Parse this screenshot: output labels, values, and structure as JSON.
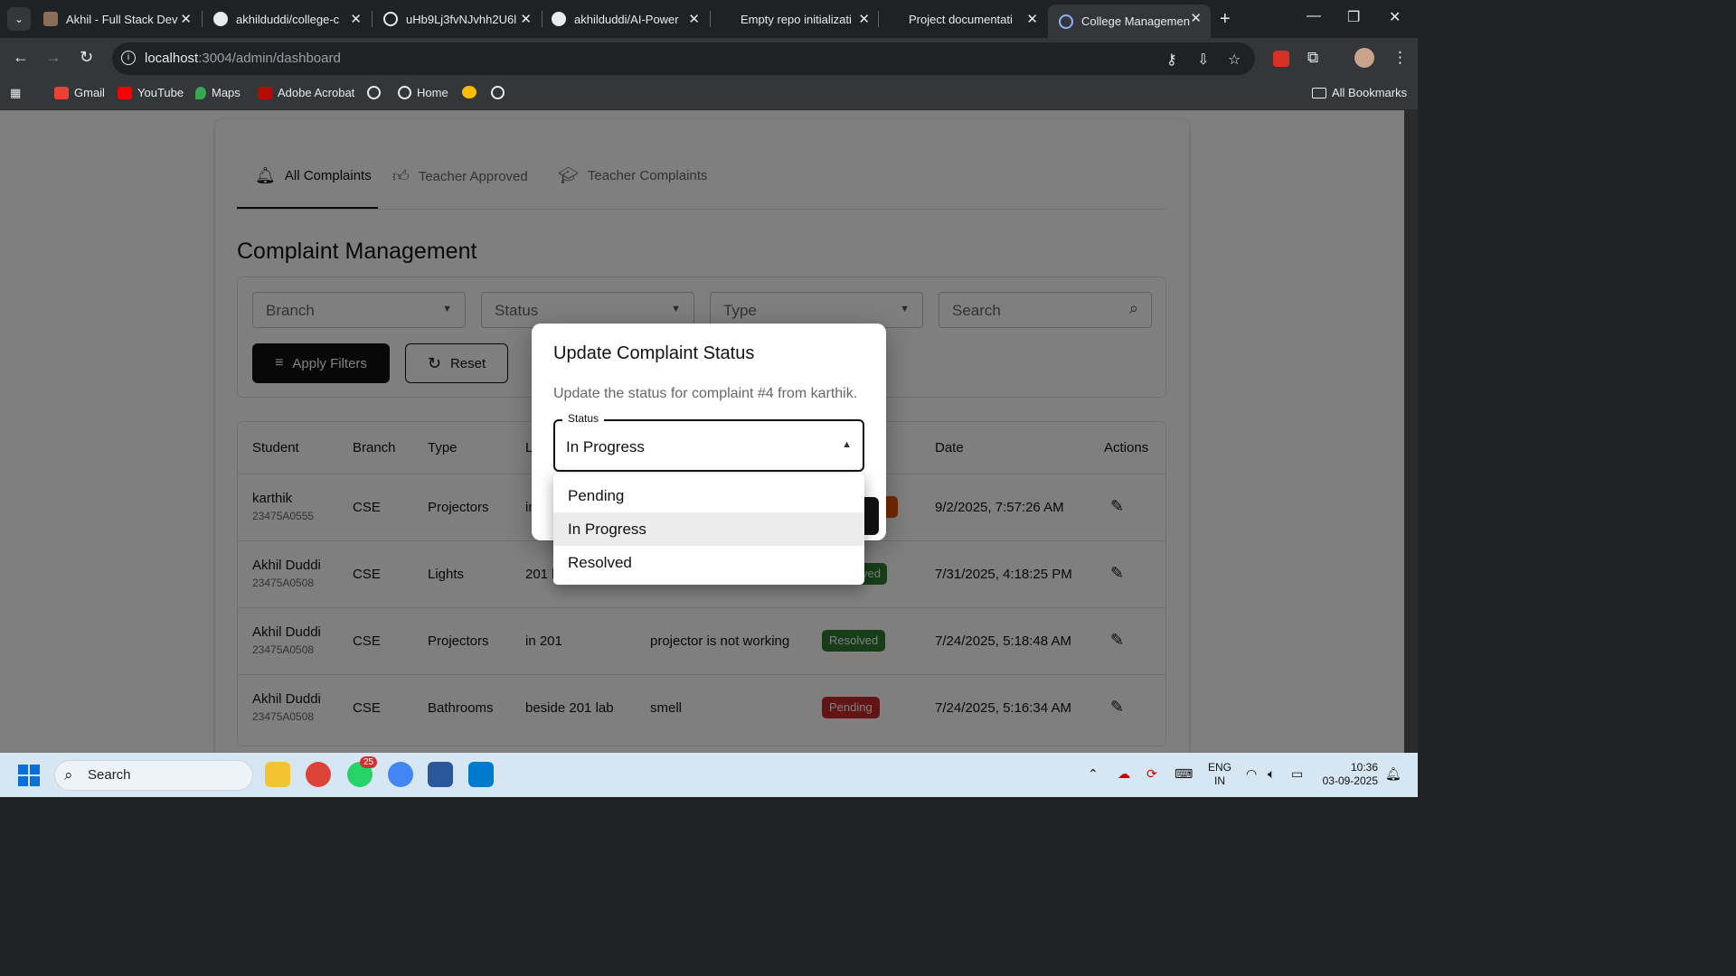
{
  "browser": {
    "tabs": [
      {
        "title": "Akhil - Full Stack Dev",
        "active": false
      },
      {
        "title": "akhilduddi/college-c",
        "active": false
      },
      {
        "title": "uHb9Lj3fvNJvhh2U6l",
        "active": false
      },
      {
        "title": "akhilduddi/AI-Power",
        "active": false
      },
      {
        "title": "Empty repo initializati",
        "active": false
      },
      {
        "title": "Project documentati",
        "active": false
      },
      {
        "title": "College Managemen",
        "active": true
      }
    ],
    "url_host": "localhost",
    "url_path": ":3004/admin/dashboard",
    "bookmarks": [
      "Gmail",
      "YouTube",
      "Maps",
      "Adobe Acrobat",
      "Home"
    ],
    "all_bookmarks": "All Bookmarks"
  },
  "page": {
    "tabs": [
      {
        "label": "All Complaints",
        "icon": "bell-icon",
        "active": true
      },
      {
        "label": "Teacher Approved",
        "icon": "thumbs-up-icon",
        "active": false
      },
      {
        "label": "Teacher Complaints",
        "icon": "school-icon",
        "active": false
      }
    ],
    "heading": "Complaint Management",
    "filters": {
      "branch": "Branch",
      "status": "Status",
      "type": "Type",
      "search_placeholder": "Search",
      "apply": "Apply Filters",
      "reset": "Reset"
    },
    "table": {
      "headers": [
        "Student",
        "Branch",
        "Type",
        "L",
        "Date",
        "Actions"
      ],
      "rows": [
        {
          "student": "karthik",
          "roll": "23475A0555",
          "branch": "CSE",
          "type": "Projectors",
          "location": "in",
          "description": "",
          "status": "",
          "date": "9/2/2025, 7:57:26 AM"
        },
        {
          "student": "Akhil Duddi",
          "roll": "23475A0508",
          "branch": "CSE",
          "type": "Lights",
          "location": "201 l",
          "description": "",
          "status": "ved",
          "date": "7/31/2025, 4:18:25 PM"
        },
        {
          "student": "Akhil Duddi",
          "roll": "23475A0508",
          "branch": "CSE",
          "type": "Projectors",
          "location": "in 201",
          "description": "projector is not working",
          "status": "Resolved",
          "date": "7/24/2025, 5:18:48 AM"
        },
        {
          "student": "Akhil Duddi",
          "roll": "23475A0508",
          "branch": "CSE",
          "type": "Bathrooms",
          "location": "beside 201 lab",
          "description": "smell",
          "status": "Pending",
          "date": "7/24/2025, 5:16:34 AM"
        }
      ]
    }
  },
  "dialog": {
    "title": "Update Complaint Status",
    "description": "Update the status for complaint #4 from karthik.",
    "field_label": "Status",
    "field_value": "In Progress",
    "options": [
      "Pending",
      "In Progress",
      "Resolved"
    ],
    "selected": "In Progress"
  },
  "taskbar": {
    "search": "Search",
    "whatsapp_badge": "25",
    "lang": "ENG",
    "region": "IN",
    "time": "10:36",
    "date": "03-09-2025"
  },
  "colors": {
    "resolved": "#2e7d32",
    "pending": "#c62828",
    "in_progress": "#e65100"
  }
}
